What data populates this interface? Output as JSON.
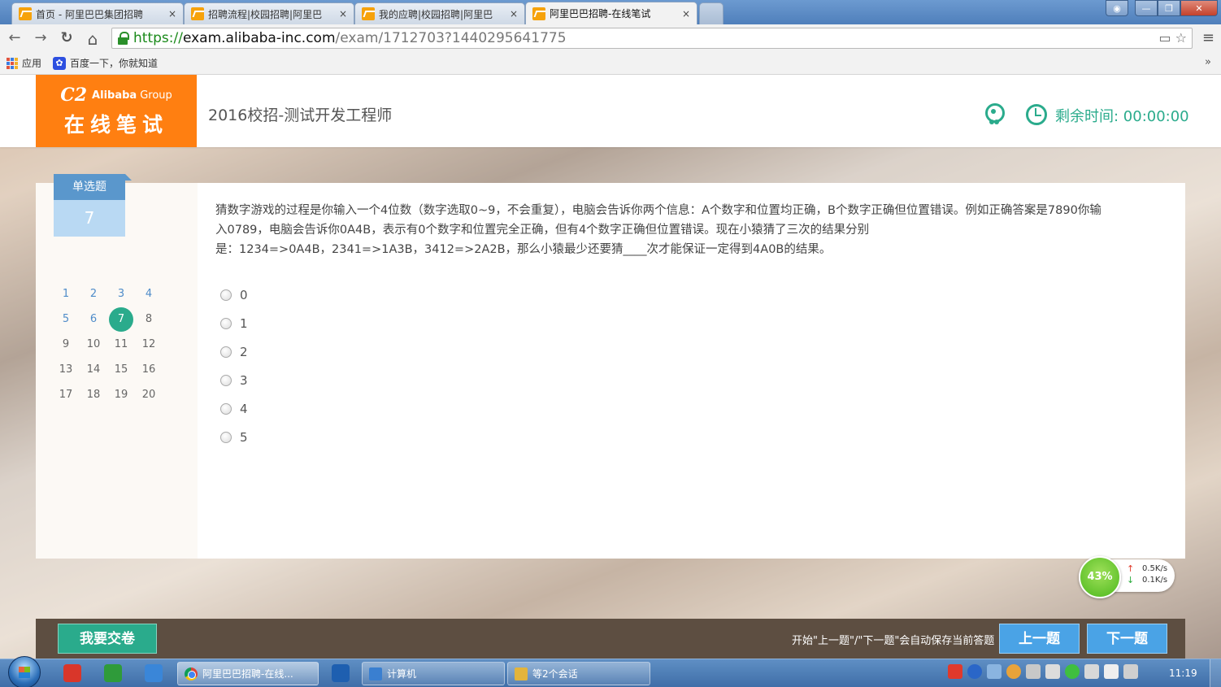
{
  "browser": {
    "tabs": [
      {
        "title": "首页 - 阿里巴巴集团招聘",
        "active": false
      },
      {
        "title": "招聘流程|校园招聘|阿里巴",
        "active": false
      },
      {
        "title": "我的应聘|校园招聘|阿里巴",
        "active": false
      },
      {
        "title": "阿里巴巴招聘-在线笔试",
        "active": true
      }
    ],
    "tab_close": "×",
    "window_buttons": {
      "minimize": "—",
      "maximize": "❐",
      "close": "✕"
    },
    "url": {
      "scheme": "https://",
      "host": "exam.alibaba-inc.com",
      "path": "/exam/1712703?1440295641775"
    },
    "icons": {
      "back": "←",
      "forward": "→",
      "reload": "↻",
      "home": "⌂",
      "star": "☆",
      "cast": "▭",
      "menu": "≡",
      "more": "»"
    },
    "bookmarks": [
      {
        "label": "应用",
        "icon": "apps-icon"
      },
      {
        "label": "百度一下，你就知道",
        "icon": "baidu-icon"
      }
    ]
  },
  "header": {
    "logo_brand": "Alibaba",
    "logo_group": "Group",
    "logo_swirl": "C2",
    "logo_subtitle": "在线笔试",
    "exam_title": "2016校招-测试开发工程师",
    "timer_label": "剩余时间: 00:00:00"
  },
  "sidebar": {
    "question_type": "单选题",
    "current_question": "7",
    "questions": [
      {
        "n": "1",
        "state": "pending"
      },
      {
        "n": "2",
        "state": "pending"
      },
      {
        "n": "3",
        "state": "pending"
      },
      {
        "n": "4",
        "state": "pending"
      },
      {
        "n": "5",
        "state": "pending"
      },
      {
        "n": "6",
        "state": "pending"
      },
      {
        "n": "7",
        "state": "current"
      },
      {
        "n": "8",
        "state": "done"
      },
      {
        "n": "9",
        "state": "done"
      },
      {
        "n": "10",
        "state": "done"
      },
      {
        "n": "11",
        "state": "done"
      },
      {
        "n": "12",
        "state": "done"
      },
      {
        "n": "13",
        "state": "done"
      },
      {
        "n": "14",
        "state": "done"
      },
      {
        "n": "15",
        "state": "done"
      },
      {
        "n": "16",
        "state": "done"
      },
      {
        "n": "17",
        "state": "done"
      },
      {
        "n": "18",
        "state": "done"
      },
      {
        "n": "19",
        "state": "done"
      },
      {
        "n": "20",
        "state": "done"
      }
    ]
  },
  "question": {
    "line1": "猜数字游戏的过程是你输入一个4位数（数字选取0~9，不会重复），电脑会告诉你两个信息：A个数字和位置均正确，B个数字正确但位置错误。例如正确答案是7890你输",
    "line2": "入0789，电脑会告诉你0A4B，表示有0个数字和位置完全正确，但有4个数字正确但位置错误。现在小猿猜了三次的结果分别",
    "line3": "是：1234=>0A4B，2341=>1A3B，3412=>2A2B，那么小猿最少还要猜____次才能保证一定得到4A0B的结果。",
    "options": [
      "0",
      "1",
      "2",
      "3",
      "4",
      "5"
    ]
  },
  "network_widget": {
    "percent": "43%",
    "upload": "0.5K/s",
    "download": "0.1K/s",
    "up_arrow": "↑",
    "down_arrow": "↓"
  },
  "footer": {
    "submit_label": "我要交卷",
    "save_hint": "开始\"上一题\"/\"下一题\"会自动保存当前答题",
    "prev_label": "上一题",
    "next_label": "下一题"
  },
  "taskbar": {
    "tasks": [
      {
        "label": "阿里巴巴招聘-在线...",
        "active": true
      },
      {
        "label": "计算机",
        "active": false
      },
      {
        "label": "等2个会话",
        "active": false
      }
    ],
    "clock": "11:19"
  },
  "colors": {
    "brand_orange": "#ff7f11",
    "accent_green": "#2aab8c",
    "nav_blue": "#4aa3e6",
    "footer_brown": "#5d4e41"
  }
}
